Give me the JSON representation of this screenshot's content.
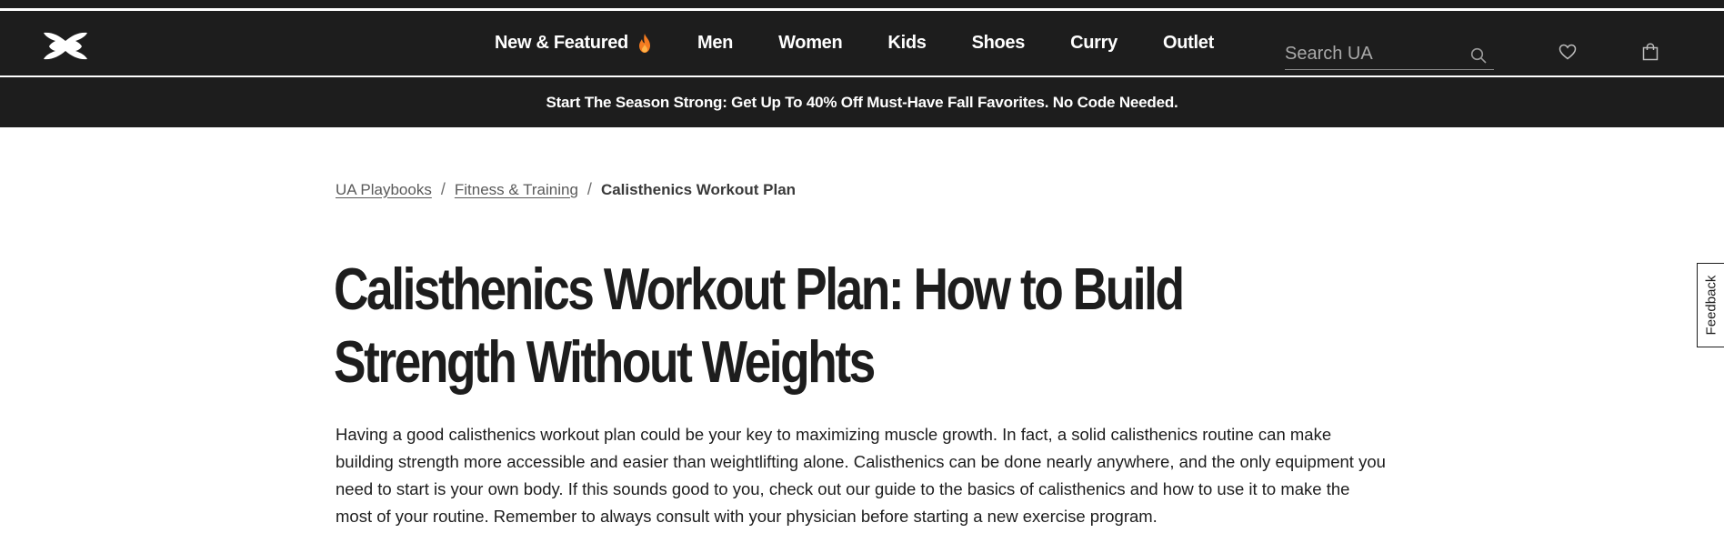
{
  "header": {
    "logo_name": "under-armour-logo",
    "nav": [
      {
        "label": "New & Featured",
        "icon": "flame-icon"
      },
      {
        "label": "Men"
      },
      {
        "label": "Women"
      },
      {
        "label": "Kids"
      },
      {
        "label": "Shoes"
      },
      {
        "label": "Curry"
      },
      {
        "label": "Outlet"
      }
    ],
    "search": {
      "placeholder": "Search UA",
      "icon": "search-icon"
    },
    "icons": [
      "heart-icon",
      "bag-icon"
    ]
  },
  "promo": {
    "text": "Start The Season Strong: Get Up To 40% Off Must-Have Fall Favorites. No Code Needed."
  },
  "breadcrumb": {
    "items": [
      "UA Playbooks",
      "Fitness & Training"
    ],
    "separator": "/",
    "current": "Calisthenics Workout Plan"
  },
  "article": {
    "title": "Calisthenics Workout Plan: How to Build Strength Without Weights",
    "intro": "Having a good calisthenics workout plan could be your key to maximizing muscle growth. In fact, a solid calisthenics routine can make building strength more accessible and easier than weightlifting alone. Calisthenics can be done nearly anywhere, and the only equipment you need to start is your own body. If this sounds good to you, check out our guide to the basics of calisthenics and how to use it to make the most of your routine. Remember to always consult with your physician before starting a new exercise program."
  },
  "feedback": {
    "label": "Feedback"
  },
  "colors": {
    "dark": "#1d1d1d",
    "flame": "#f47b20",
    "white": "#ffffff"
  }
}
